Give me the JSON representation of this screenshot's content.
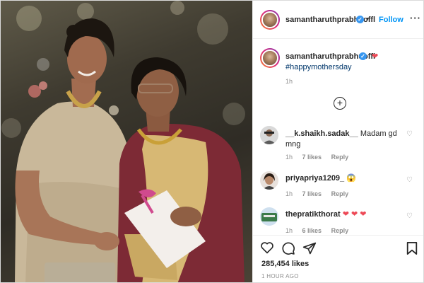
{
  "post": {
    "username": "samantharuthprabhuoffl",
    "follow_label": "Follow",
    "separator": "•",
    "more_icon": "more-icon",
    "verified_mark": "✓"
  },
  "caption": {
    "username": "samantharuthprabhuoffl",
    "emoji": "❤",
    "hashtag": "#happymothersday",
    "time": "1h"
  },
  "load_more_symbol": "+",
  "comments": [
    {
      "username": "__k.shaikh.sadak__",
      "text": "Madam gd mng",
      "time": "1h",
      "likes": "7 likes",
      "reply": "Reply"
    },
    {
      "username": "priyapriya1209_",
      "text": "😱",
      "time": "1h",
      "likes": "7 likes",
      "reply": "Reply"
    },
    {
      "username": "thepratikthorat",
      "text": "❤ ❤ ❤",
      "time": "1h",
      "likes": "6 likes",
      "reply": "Reply"
    }
  ],
  "likes_count": "285,454 likes",
  "post_time": "1 HOUR AGO",
  "icons": [
    "heart-icon",
    "comment-icon",
    "share-icon",
    "bookmark-icon",
    "add-circle-icon"
  ],
  "colors": {
    "link_blue": "#0095f6",
    "heart_red": "#ed4956",
    "muted": "#8e8e8e"
  }
}
